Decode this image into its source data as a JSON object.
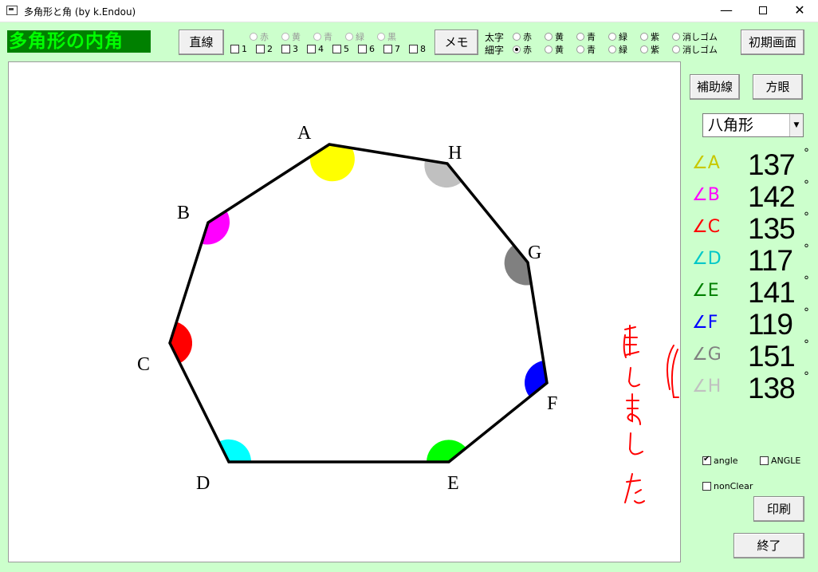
{
  "window": {
    "title": "多角形と角 (by k.Endou)",
    "min": "—",
    "close": "✕"
  },
  "app": {
    "title": "多角形の内角"
  },
  "toolbar": {
    "line_label": "直線",
    "memo_label": "メモ",
    "reset_label": "初期画面",
    "line_colors": [
      "赤",
      "黄",
      "青",
      "緑",
      "黒"
    ],
    "line_numbers": [
      "1",
      "2",
      "3",
      "4",
      "5",
      "6",
      "7",
      "8"
    ],
    "thick_label": "太字",
    "thin_label": "細字",
    "pen_colors": [
      "赤",
      "黄",
      "青",
      "緑",
      "紫",
      "消しゴム"
    ],
    "thin_selected": "赤"
  },
  "side": {
    "aux_label": "補助線",
    "grid_label": "方眼",
    "polygon_select": "八角形",
    "angles": [
      {
        "label": "∠A",
        "value": "137",
        "color": "#c8c800"
      },
      {
        "label": "∠B",
        "value": "142",
        "color": "#ff00ff"
      },
      {
        "label": "∠C",
        "value": "135",
        "color": "#ff0000"
      },
      {
        "label": "∠D",
        "value": "117",
        "color": "#00c8c8"
      },
      {
        "label": "∠E",
        "value": "141",
        "color": "#008000"
      },
      {
        "label": "∠F",
        "value": "119",
        "color": "#0000ff"
      },
      {
        "label": "∠G",
        "value": "151",
        "color": "#808080"
      },
      {
        "label": "∠H",
        "value": "138",
        "color": "#c0c0c0"
      }
    ],
    "degree": "°",
    "check_angle": "angle",
    "check_angle_caps": "ANGLE",
    "check_nonclear": "nonClear",
    "print_label": "印刷",
    "exit_label": "終了"
  },
  "canvas": {
    "vertices": [
      {
        "name": "A"
      },
      {
        "name": "B"
      },
      {
        "name": "C"
      },
      {
        "name": "D"
      },
      {
        "name": "E"
      },
      {
        "name": "F"
      },
      {
        "name": "G"
      },
      {
        "name": "H"
      }
    ]
  }
}
